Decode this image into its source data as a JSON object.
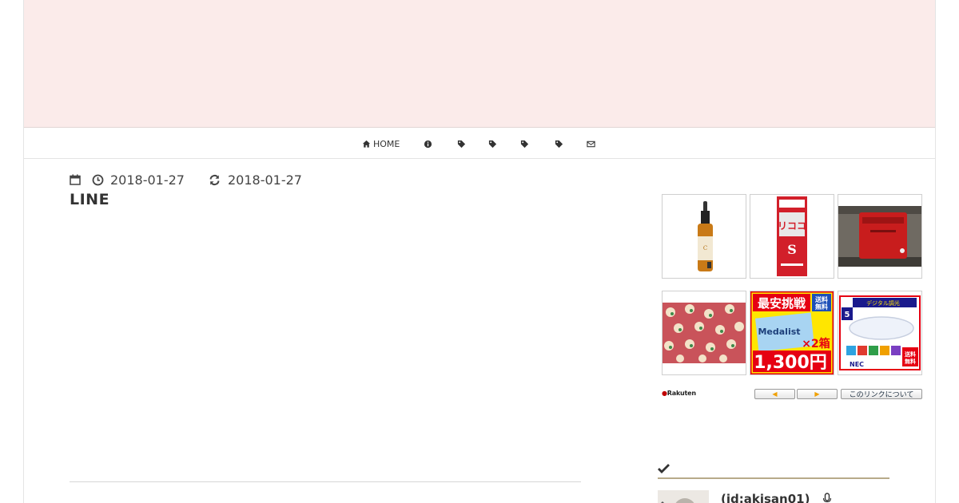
{
  "header": {
    "banner_color": "#fbebea"
  },
  "nav": {
    "items": [
      {
        "icon": "home-icon",
        "label": "HOME"
      },
      {
        "icon": "info-icon",
        "label": ""
      },
      {
        "icon": "tag-icon",
        "label": ""
      },
      {
        "icon": "tag-icon",
        "label": ""
      },
      {
        "icon": "tag-icon",
        "label": ""
      },
      {
        "icon": "tag-icon",
        "label": ""
      },
      {
        "icon": "envelope-icon",
        "label": ""
      }
    ]
  },
  "post": {
    "published": "2018-01-27",
    "updated": "2018-01-27",
    "title": "LINE"
  },
  "rakuten_widget": {
    "logo_text": "Rakuten",
    "prev_label": "◀",
    "next_label": "▶",
    "about_label": "このリンクについて",
    "products": [
      {
        "name": "serum-bottle-product",
        "text": ""
      },
      {
        "name": "medicine-box-product",
        "text": "リココデ S"
      },
      {
        "name": "red-mailbox-product",
        "text": ""
      },
      {
        "name": "fabric-product",
        "text": ""
      },
      {
        "name": "mask-box-product",
        "text": "最安挑戦 送料無料 Medalist ×2箱 1,300円"
      },
      {
        "name": "ceiling-light-product",
        "text": "NEC 送料無料"
      }
    ]
  },
  "sidebar": {
    "section_icon": "check-icon",
    "profile_id": "(id:akisan01)",
    "accent": "#b7aa8a"
  }
}
